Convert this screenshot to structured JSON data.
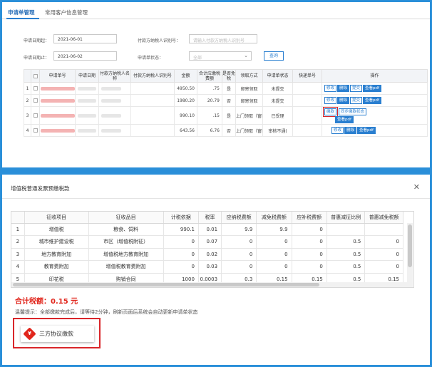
{
  "tabs": [
    "申请单管理",
    "常用客户信息管理"
  ],
  "filters": {
    "start_label": "申请日期起：",
    "start_value": "2021-06-01",
    "end_label": "申请日期止：",
    "end_value": "2021-06-02",
    "taxid_label": "付款方纳税人识别号：",
    "taxid_placeholder": "请输入付款方纳税人识别号",
    "status_label": "申请单状态：",
    "status_value": "全部",
    "query_button": "查询"
  },
  "list_headers": [
    "申请单号",
    "申请日期",
    "付款方纳税人名称",
    "付款方纳税人识别号",
    "金额",
    "合计应缴税费额",
    "是否免税",
    "领取方式",
    "申请单状态",
    "快递单号",
    "操作"
  ],
  "list_rows": [
    {
      "no": "1",
      "amount": "4950.50",
      "tax": ".75",
      "exempt": "是",
      "method": "邮寄领取",
      "status": "未提交"
    },
    {
      "no": "2",
      "amount": "1980.20",
      "tax": "20.79",
      "exempt": "否",
      "method": "邮寄领取",
      "status": "未提交"
    },
    {
      "no": "3",
      "amount": "990.10",
      "tax": ".15",
      "exempt": "是",
      "method": "上门领取（窗口",
      "status": "已受理"
    },
    {
      "no": "4",
      "amount": "643.56",
      "tax": "6.76",
      "exempt": "否",
      "method": "上门领取（窗口",
      "status": "审核不通("
    }
  ],
  "ops": {
    "edit": "修改",
    "delete": "删除",
    "submit": "提交",
    "view_pdf": "查看pdf",
    "pay": "缴款",
    "sync": "同步缴款状态"
  },
  "dialog": {
    "title": "增值税普通发票预缴税款",
    "headers": [
      "征收项目",
      "征收品目",
      "计税依据",
      "税率",
      "应纳税费额",
      "减免税费额",
      "应补税费额",
      "普惠减征比例",
      "普惠减免税额"
    ],
    "rows": [
      [
        "1",
        "增值税",
        "粮食、饲料",
        "990.1",
        "0.01",
        "9.9",
        "9.9",
        "0",
        "",
        ""
      ],
      [
        "2",
        "城市维护建设税",
        "市区（增值税附征）",
        "0",
        "0.07",
        "0",
        "0",
        "0",
        "0.5",
        "0"
      ],
      [
        "3",
        "地方教育附加",
        "增值税地方教育附加",
        "0",
        "0.02",
        "0",
        "0",
        "0",
        "0.5",
        "0"
      ],
      [
        "4",
        "教育费附加",
        "增值税教育费附加",
        "0",
        "0.03",
        "0",
        "0",
        "0",
        "0.5",
        "0"
      ],
      [
        "5",
        "印花税",
        "购销合同",
        "1000",
        "0.0003",
        "0.3",
        "0.15",
        "0.15",
        "0.5",
        "0.15"
      ]
    ],
    "total": "合计税额：0.15 元",
    "hint": "温馨提示：全部缴款完成后，请等待2分钟，刷新页面后系统会自动更新申请单状态",
    "pay_button": "三方协议缴款",
    "pay_icon": "¥"
  }
}
